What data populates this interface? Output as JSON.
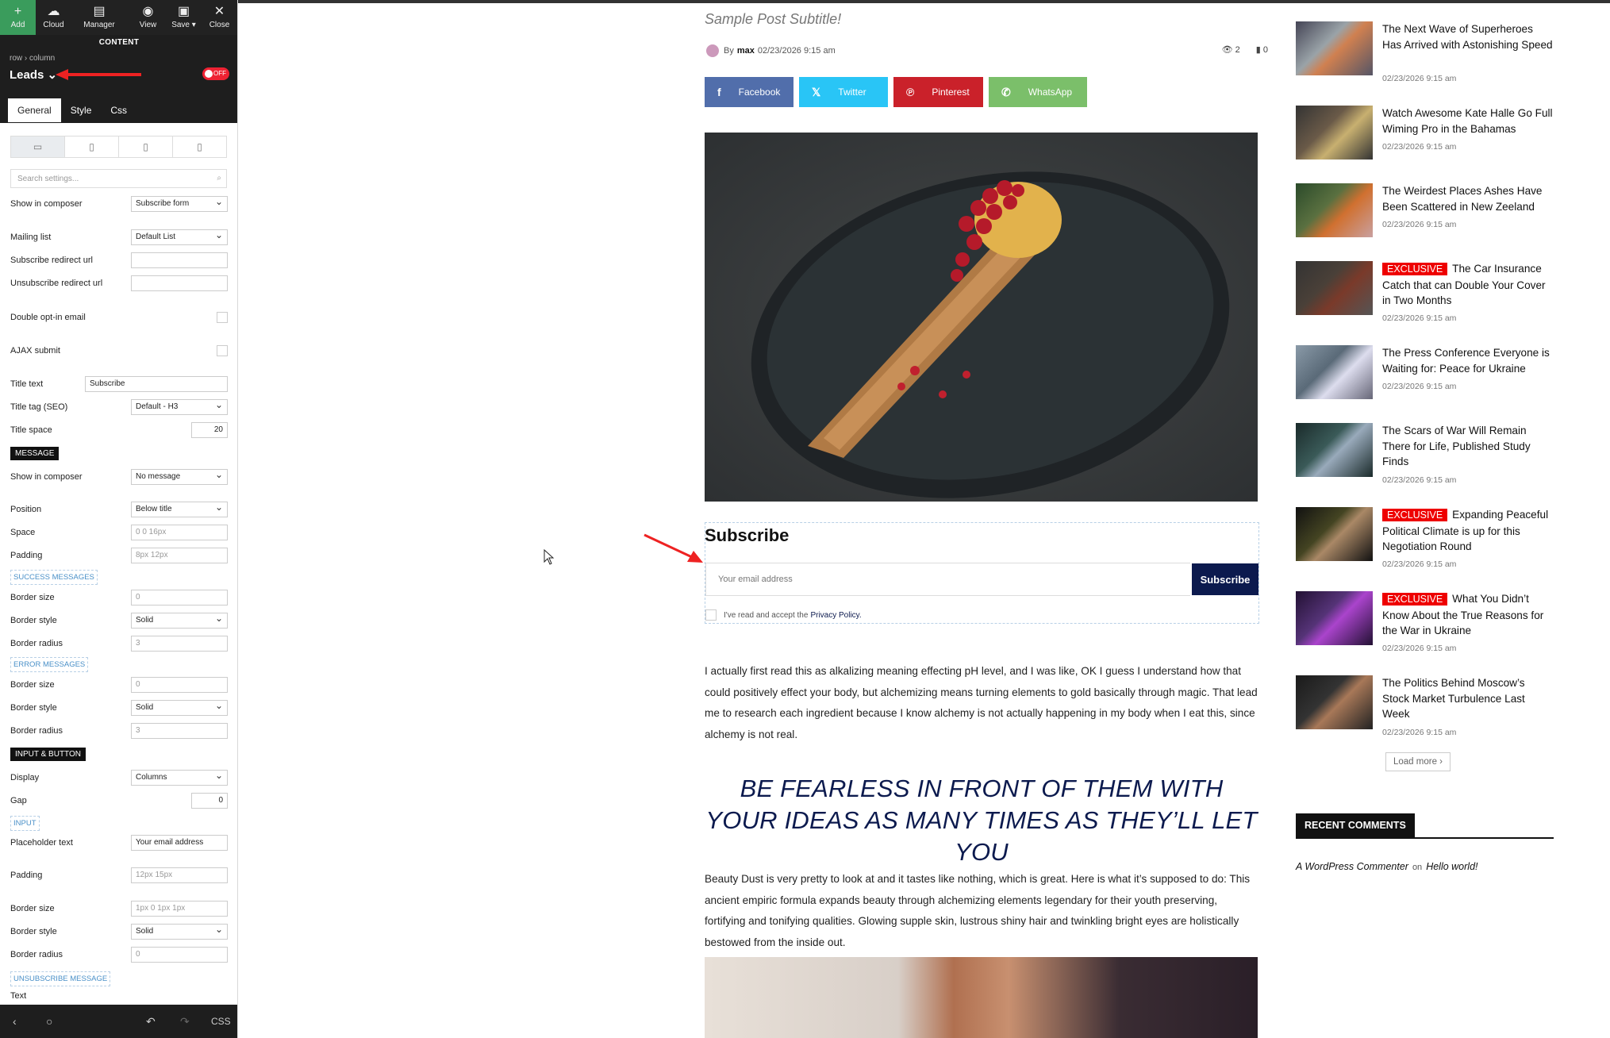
{
  "colors": {
    "accent": "#0c1a4e",
    "add_green": "#3a9c5c",
    "exclusive_red": "#e00",
    "facebook": "#516eab",
    "twitter": "#29c5f6",
    "pinterest": "#ca212a",
    "whatsapp": "#7bbf6a"
  },
  "editor": {
    "toolbar": {
      "add": "Add",
      "cloud": "Cloud",
      "manager": "Manager",
      "view": "View",
      "save": "Save ▾",
      "close": "Close"
    },
    "section": "CONTENT",
    "breadcrumb": "row › column",
    "element": "Leads ⌄",
    "toggle": "OFF",
    "tabs": [
      "General",
      "Style",
      "Css"
    ],
    "search_placeholder": "Search settings...",
    "fields": {
      "show_in_composer": {
        "label": "Show in composer",
        "value": "Subscribe form"
      },
      "mailing_list": {
        "label": "Mailing list",
        "value": "Default List"
      },
      "subscribe_redirect": {
        "label": "Subscribe redirect url",
        "value": ""
      },
      "unsubscribe_redirect": {
        "label": "Unsubscribe redirect url",
        "value": ""
      },
      "double_optin": {
        "label": "Double opt-in email"
      },
      "ajax_submit": {
        "label": "AJAX submit"
      },
      "title_text": {
        "label": "Title text",
        "value": "Subscribe"
      },
      "title_tag": {
        "label": "Title tag (SEO)",
        "value": "Default - H3"
      },
      "title_space": {
        "label": "Title space",
        "value": "20"
      },
      "msg_show": {
        "label": "Show in composer",
        "value": "No message"
      },
      "position": {
        "label": "Position",
        "value": "Below title"
      },
      "space": {
        "label": "Space",
        "placeholder": "0 0 16px"
      },
      "padding": {
        "label": "Padding",
        "placeholder": "8px 12px"
      },
      "succ_border_size": {
        "label": "Border size",
        "placeholder": "0"
      },
      "succ_border_style": {
        "label": "Border style",
        "value": "Solid"
      },
      "succ_border_radius": {
        "label": "Border radius",
        "placeholder": "3"
      },
      "err_border_size": {
        "label": "Border size",
        "placeholder": "0"
      },
      "err_border_style": {
        "label": "Border style",
        "value": "Solid"
      },
      "err_border_radius": {
        "label": "Border radius",
        "placeholder": "3"
      },
      "display": {
        "label": "Display",
        "value": "Columns"
      },
      "gap": {
        "label": "Gap",
        "value": "0"
      },
      "placeholder_text": {
        "label": "Placeholder text",
        "value": "Your email address"
      },
      "input_padding": {
        "label": "Padding",
        "placeholder": "12px 15px"
      },
      "input_border_size": {
        "label": "Border size",
        "placeholder": "1px 0 1px 1px"
      },
      "input_border_style": {
        "label": "Border style",
        "value": "Solid"
      },
      "input_border_radius": {
        "label": "Border radius",
        "placeholder": "0"
      },
      "text": {
        "label": "Text"
      }
    },
    "sections": {
      "message": "MESSAGE",
      "success": "SUCCESS MESSAGES",
      "error": "ERROR MESSAGES",
      "input_button": "INPUT & BUTTON",
      "input": "INPUT",
      "unsubscribe": "UNSUBSCRIBE MESSAGE"
    },
    "bottom": {
      "back": "‹",
      "circle": "○",
      "undo": "↶",
      "redo": "↷",
      "css": "CSS"
    }
  },
  "post": {
    "subtitle": "Sample Post Subtitle!",
    "by": "By",
    "author": "max",
    "date": "02/23/2026 9:15 am",
    "views": "2",
    "comments": "0",
    "share": [
      {
        "icon": "f",
        "label": "Facebook"
      },
      {
        "icon": "𝕏",
        "label": "Twitter"
      },
      {
        "icon": "℗",
        "label": "Pinterest"
      },
      {
        "icon": "✆",
        "label": "WhatsApp"
      }
    ],
    "subscribe": {
      "title": "Subscribe",
      "placeholder": "Your email address",
      "button": "Subscribe",
      "accept": "I've read and accept the",
      "policy": "Privacy Policy."
    },
    "para1": "I actually first read this as alkalizing meaning effecting pH level, and I was like, OK I guess I understand how that could positively effect your body, but alchemizing means turning elements to gold basically through magic. That lead me to research each ingredient because I know alchemy is not actually happening in my body when I eat this, since alchemy is not real.",
    "quote": "BE FEARLESS IN FRONT OF THEM WITH YOUR IDEAS AS MANY TIMES AS THEY’LL LET YOU",
    "para2": "Beauty Dust is very pretty to look at and it tastes like nothing, which is great. Here is what it’s supposed to do: This ancient empiric formula expands beauty through alchemizing elements legendary for their youth preserving, fortifying and tonifying qualities. Glowing supple skin, lustrous shiny hair and twinkling bright eyes are holistically bestowed from the inside out."
  },
  "sidebar_posts": [
    {
      "title": "The Next Wave of Superheroes Has Arrived with Astonishing Speed",
      "date": "02/23/2026 9:15 am",
      "exclusive": ""
    },
    {
      "title": "Watch Awesome Kate Halle Go Full Wiming Pro in the Bahamas",
      "date": "02/23/2026 9:15 am",
      "exclusive": ""
    },
    {
      "title": "The Weirdest Places Ashes Have Been Scattered in New Zeeland",
      "date": "02/23/2026 9:15 am",
      "exclusive": ""
    },
    {
      "title": "The Car Insurance Catch that can Double Your Cover in Two Months",
      "date": "02/23/2026 9:15 am",
      "exclusive": "EXCLUSIVE"
    },
    {
      "title": "The Press Conference Everyone is Waiting for: Peace for Ukraine",
      "date": "02/23/2026 9:15 am",
      "exclusive": ""
    },
    {
      "title": "The Scars of War Will Remain There for Life, Published Study Finds",
      "date": "02/23/2026 9:15 am",
      "exclusive": ""
    },
    {
      "title": "Expanding Peaceful Political Climate is up for this Negotiation Round",
      "date": "02/23/2026 9:15 am",
      "exclusive": "EXCLUSIVE"
    },
    {
      "title": "What You Didn’t Know About the True Reasons for the War in Ukraine",
      "date": "02/23/2026 9:15 am",
      "exclusive": "EXCLUSIVE"
    },
    {
      "title": "The Politics Behind Moscow’s Stock Market Turbulence Last Week",
      "date": "02/23/2026 9:15 am",
      "exclusive": ""
    }
  ],
  "load_more": "Load more ›",
  "recent_comments": {
    "title": "RECENT COMMENTS",
    "author": "A WordPress Commenter",
    "on": "on",
    "post": "Hello world!"
  }
}
